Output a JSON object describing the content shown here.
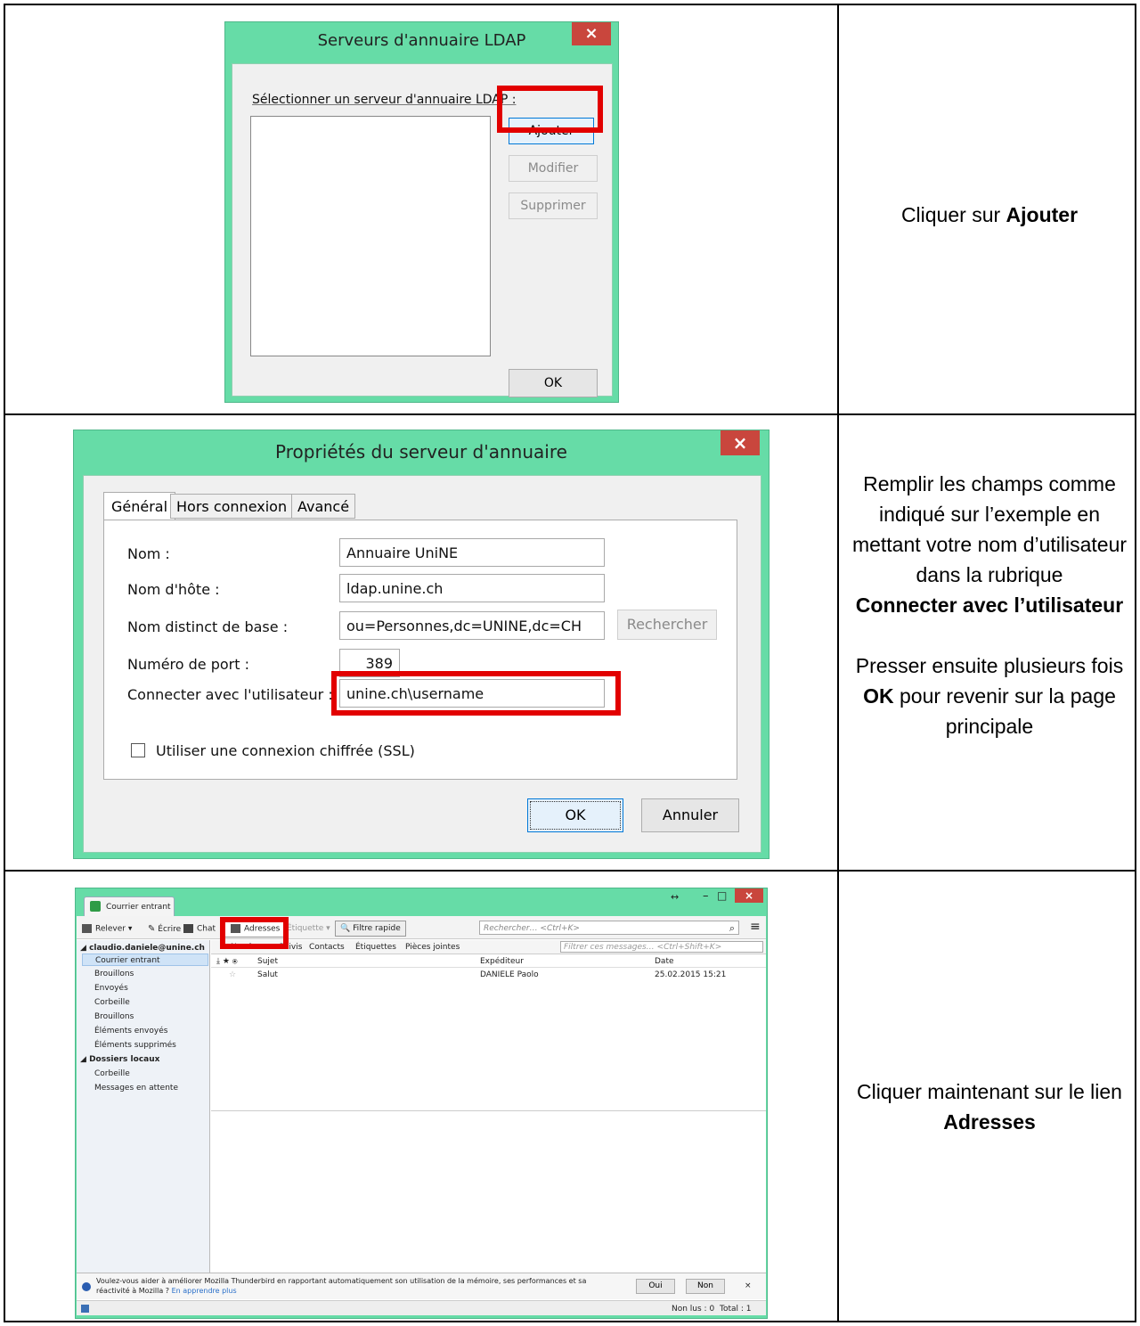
{
  "row1": {
    "instruction_prefix": "Cliquer sur ",
    "instruction_bold": "Ajouter",
    "dialog": {
      "title": "Serveurs d'annuaire LDAP",
      "close": "×",
      "list_label": "Sélectionner un serveur d'annuaire LDAP :",
      "add": "Ajouter",
      "edit": "Modifier",
      "delete": "Supprimer",
      "ok": "OK"
    }
  },
  "row2": {
    "instruction_p1": "Remplir les champs comme indiqué sur l’exemple en mettant votre nom d’utilisateur dans la rubrique",
    "instruction_p1_bold": "Connecter avec l’utilisateur",
    "instruction_p2_a": "Presser ensuite plusieurs fois ",
    "instruction_p2_bold": "OK",
    "instruction_p2_b": " pour revenir sur la page principale",
    "dialog": {
      "title": "Propriétés du serveur d'annuaire",
      "close": "×",
      "tabs": [
        "Général",
        "Hors connexion",
        "Avancé"
      ],
      "fields": [
        {
          "label": "Nom :",
          "value": "Annuaire UniNE"
        },
        {
          "label": "Nom d'hôte :",
          "value": "ldap.unine.ch"
        },
        {
          "label": "Nom distinct de base :",
          "value": "ou=Personnes,dc=UNINE,dc=CH"
        },
        {
          "label": "Numéro de port :",
          "value": "389"
        },
        {
          "label": "Connecter avec l'utilisateur :",
          "value": "unine.ch\\username"
        }
      ],
      "search": "Rechercher",
      "ssl": "Utiliser une connexion chiffrée (SSL)",
      "ok": "OK",
      "cancel": "Annuler"
    }
  },
  "row3": {
    "instruction_prefix": "Cliquer maintenant sur le lien ",
    "instruction_bold": "Adresses",
    "tb": {
      "tab": "Courrier entrant",
      "toolbar": [
        "Relever",
        "Écrire",
        "Chat",
        "Adresses",
        "Étiquette",
        "Filtre rapide"
      ],
      "search": "Rechercher… <Ctrl+K>",
      "filter_bar": [
        "Non lus",
        "Suivis",
        "Contacts",
        "Étiquettes",
        "Pièces jointes"
      ],
      "filter_search": "Filtrer ces messages… <Ctrl+Shift+K>",
      "account": "claudio.daniele@unine.ch",
      "folders": [
        "Courrier entrant",
        "Brouillons",
        "Envoyés",
        "Corbeille",
        "Brouillons",
        "Éléments envoyés",
        "Éléments supprimés"
      ],
      "local": "Dossiers locaux",
      "local_folders": [
        "Corbeille",
        "Messages en attente"
      ],
      "columns": [
        "Sujet",
        "Expéditeur",
        "Date"
      ],
      "message": {
        "subject": "Salut",
        "sender": "DANIELE Paolo",
        "date": "25.02.2015 15:21"
      },
      "notice": "Voulez-vous aider à améliorer Mozilla Thunderbird en rapportant automatiquement son utilisation de la mémoire, ses performances et sa réactivité à Mozilla ?",
      "notice_link": "En apprendre plus",
      "yes": "Oui",
      "no": "Non",
      "status_unread": "Non lus : 0",
      "status_total": "Total : 1"
    }
  }
}
